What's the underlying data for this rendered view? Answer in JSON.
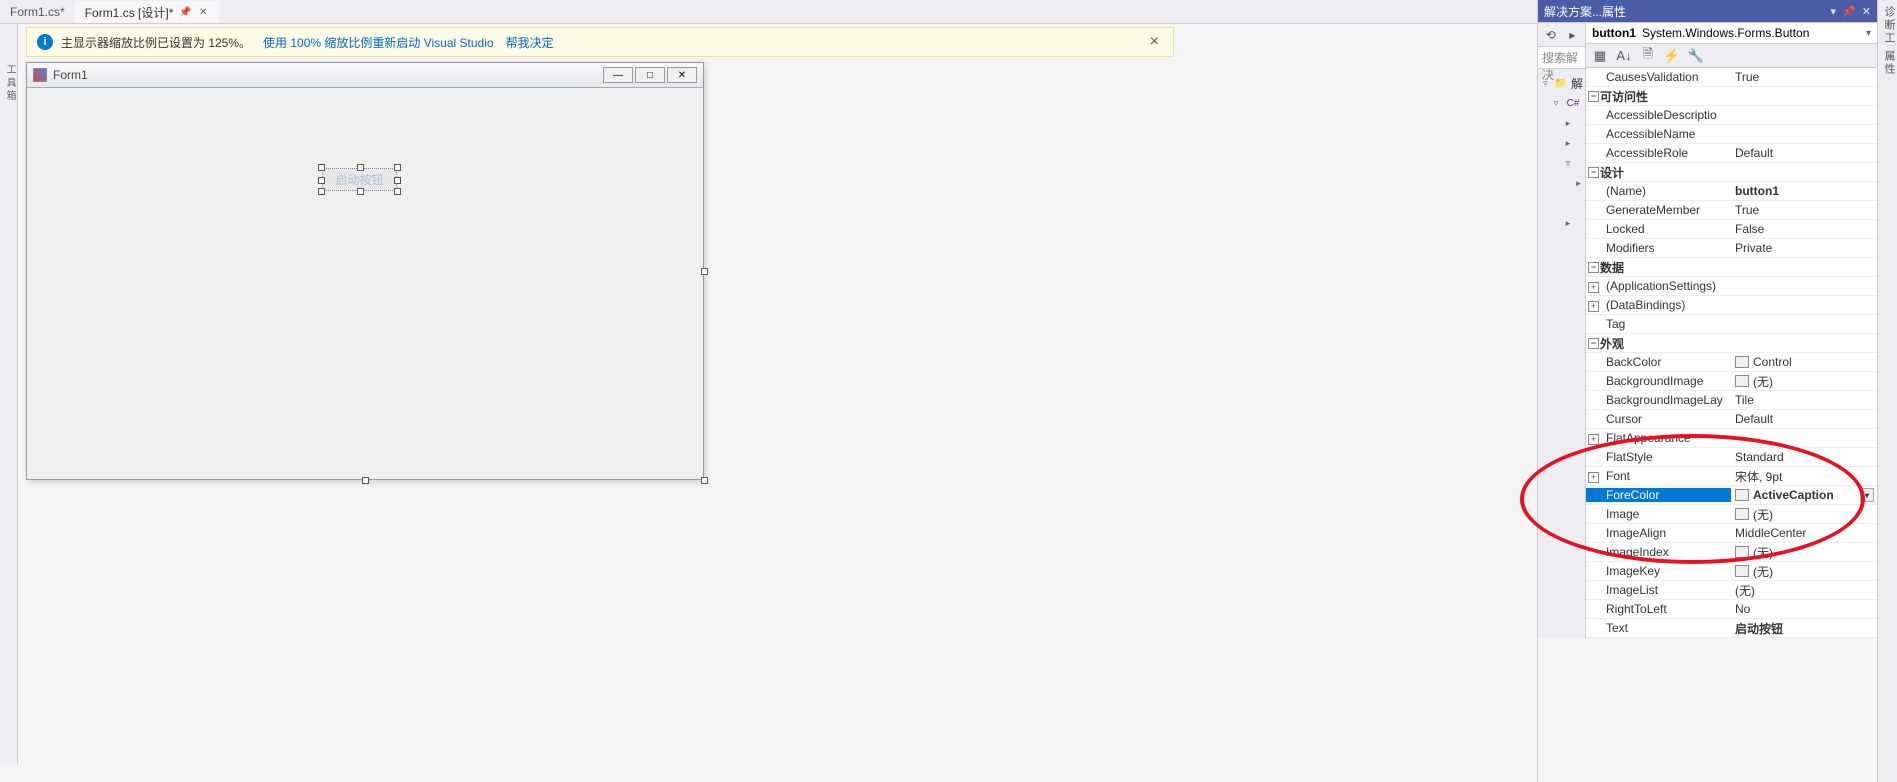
{
  "tabs": [
    {
      "label": "Form1.cs*"
    },
    {
      "label": "Form1.cs [设计]*"
    }
  ],
  "notification": {
    "text": "主显示器缩放比例已设置为 125%。",
    "link1": "使用 100% 缩放比例重新启动 Visual Studio",
    "link2": "帮我决定"
  },
  "form": {
    "title": "Form1",
    "button_text": "启动按钮"
  },
  "solution": {
    "header": "解决方案...属性",
    "search_placeholder": "搜索解决",
    "node_label": "解"
  },
  "properties": {
    "object_name": "button1",
    "object_type": "System.Windows.Forms.Button",
    "rows": [
      {
        "kind": "prop",
        "name": "CausesValidation",
        "value": "True"
      },
      {
        "kind": "cat",
        "name": "可访问性",
        "exp": "-"
      },
      {
        "kind": "prop",
        "name": "AccessibleDescriptio",
        "value": ""
      },
      {
        "kind": "prop",
        "name": "AccessibleName",
        "value": ""
      },
      {
        "kind": "prop",
        "name": "AccessibleRole",
        "value": "Default"
      },
      {
        "kind": "cat",
        "name": "设计",
        "exp": "-"
      },
      {
        "kind": "prop",
        "name": "(Name)",
        "value": "button1",
        "bold": true
      },
      {
        "kind": "prop",
        "name": "GenerateMember",
        "value": "True"
      },
      {
        "kind": "prop",
        "name": "Locked",
        "value": "False"
      },
      {
        "kind": "prop",
        "name": "Modifiers",
        "value": "Private"
      },
      {
        "kind": "cat",
        "name": "数据",
        "exp": "-"
      },
      {
        "kind": "prop",
        "name": "(ApplicationSettings)",
        "value": "",
        "exp": "+"
      },
      {
        "kind": "prop",
        "name": "(DataBindings)",
        "value": "",
        "exp": "+"
      },
      {
        "kind": "prop",
        "name": "Tag",
        "value": ""
      },
      {
        "kind": "cat",
        "name": "外观",
        "exp": "-"
      },
      {
        "kind": "prop",
        "name": "BackColor",
        "value": "Control",
        "swatch": true
      },
      {
        "kind": "prop",
        "name": "BackgroundImage",
        "value": "(无)",
        "swatch": true
      },
      {
        "kind": "prop",
        "name": "BackgroundImageLay",
        "value": "Tile"
      },
      {
        "kind": "prop",
        "name": "Cursor",
        "value": "Default"
      },
      {
        "kind": "prop",
        "name": "FlatAppearance",
        "value": "",
        "exp": "+"
      },
      {
        "kind": "prop",
        "name": "FlatStyle",
        "value": "Standard"
      },
      {
        "kind": "prop",
        "name": "Font",
        "value": "宋体, 9pt",
        "exp": "+"
      },
      {
        "kind": "prop",
        "name": "ForeColor",
        "value": "ActiveCaption",
        "swatch": true,
        "selected": true,
        "bold": true,
        "dd": true
      },
      {
        "kind": "prop",
        "name": "Image",
        "value": "(无)",
        "swatch": true
      },
      {
        "kind": "prop",
        "name": "ImageAlign",
        "value": "MiddleCenter"
      },
      {
        "kind": "prop",
        "name": "ImageIndex",
        "value": "(无)",
        "swatch": true
      },
      {
        "kind": "prop",
        "name": "ImageKey",
        "value": "(无)",
        "swatch": true
      },
      {
        "kind": "prop",
        "name": "ImageList",
        "value": "(无)"
      },
      {
        "kind": "prop",
        "name": "RightToLeft",
        "value": "No"
      },
      {
        "kind": "prop",
        "name": "Text",
        "value": "启动按钮",
        "bold": true
      }
    ]
  },
  "vert_tabs": {
    "right1": "诊断工具",
    "right2": "属性",
    "left": "工具箱"
  }
}
